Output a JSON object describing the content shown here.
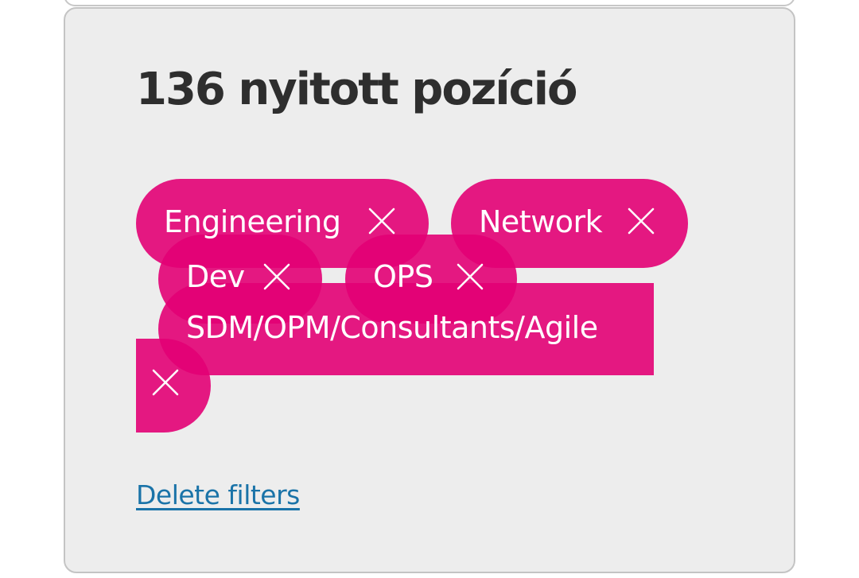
{
  "results": {
    "title": "136 nyitott pozíció"
  },
  "filters": {
    "chips": [
      {
        "label": "Engineering"
      },
      {
        "label": "Network"
      },
      {
        "label": "Dev"
      },
      {
        "label": "OPS"
      },
      {
        "label": "SDM/OPM/Consultants/Agile"
      }
    ],
    "accent_color": "#e20074"
  },
  "actions": {
    "delete_filters_label": "Delete filters"
  }
}
